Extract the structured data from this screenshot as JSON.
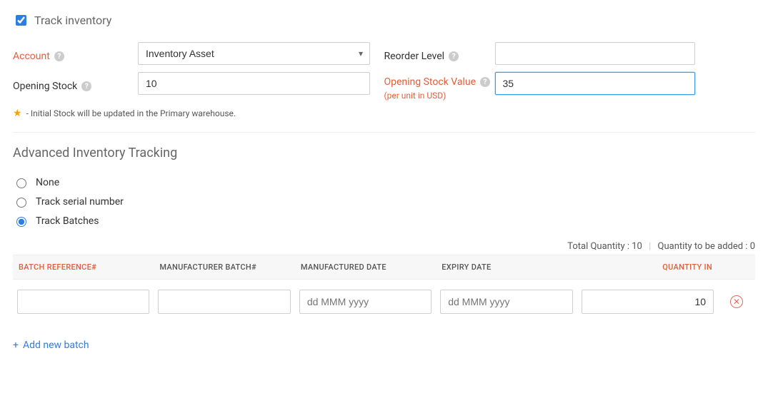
{
  "trackInventory": {
    "label": "Track inventory",
    "checked": true
  },
  "fields": {
    "account": {
      "label": "Account",
      "value": "Inventory Asset"
    },
    "reorderLevel": {
      "label": "Reorder Level",
      "value": ""
    },
    "openingStock": {
      "label": "Opening Stock",
      "value": "10"
    },
    "openingStockValue": {
      "label": "Opening Stock Value",
      "value": "35",
      "subNote": "(per unit in USD)"
    }
  },
  "primaryNote": "- Initial Stock will be updated in the Primary warehouse.",
  "advanced": {
    "title": "Advanced Inventory Tracking",
    "options": {
      "none": "None",
      "serial": "Track serial number",
      "batches": "Track Batches"
    },
    "selected": "batches",
    "summary": {
      "totalLabel": "Total Quantity :",
      "totalValue": "10",
      "toAddLabel": "Quantity to be added :",
      "toAddValue": "0"
    },
    "columns": {
      "batchRef": "BATCH REFERENCE#",
      "mfgBatch": "MANUFACTURER BATCH#",
      "mfgDate": "MANUFACTURED DATE",
      "expiry": "EXPIRY DATE",
      "qtyIn": "QUANTITY IN"
    },
    "row": {
      "batchRef": "",
      "mfgBatch": "",
      "mfgDatePlaceholder": "dd MMM yyyy",
      "expiryPlaceholder": "dd MMM yyyy",
      "qtyIn": "10"
    },
    "addLink": "Add new batch"
  }
}
